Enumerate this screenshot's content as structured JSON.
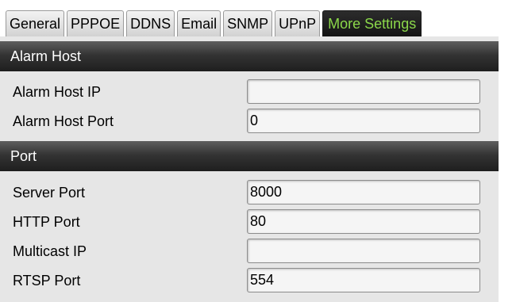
{
  "tabs": [
    {
      "label": "General",
      "active": false
    },
    {
      "label": "PPPOE",
      "active": false
    },
    {
      "label": "DDNS",
      "active": false
    },
    {
      "label": "Email",
      "active": false
    },
    {
      "label": "SNMP",
      "active": false
    },
    {
      "label": "UPnP",
      "active": false
    },
    {
      "label": "More Settings",
      "active": true
    }
  ],
  "alarm_host": {
    "title": "Alarm Host",
    "ip_label": "Alarm Host IP",
    "ip_value": "",
    "port_label": "Alarm Host Port",
    "port_value": "0"
  },
  "port": {
    "title": "Port",
    "server_port_label": "Server Port",
    "server_port_value": "8000",
    "http_port_label": "HTTP Port",
    "http_port_value": "80",
    "multicast_ip_label": "Multicast IP",
    "multicast_ip_value": "",
    "rtsp_port_label": "RTSP Port",
    "rtsp_port_value": "554"
  },
  "colors": {
    "active_tab_text": "#8bd84a",
    "header_bg": "#2a2a2a",
    "panel_bg": "#e6e6e6"
  }
}
